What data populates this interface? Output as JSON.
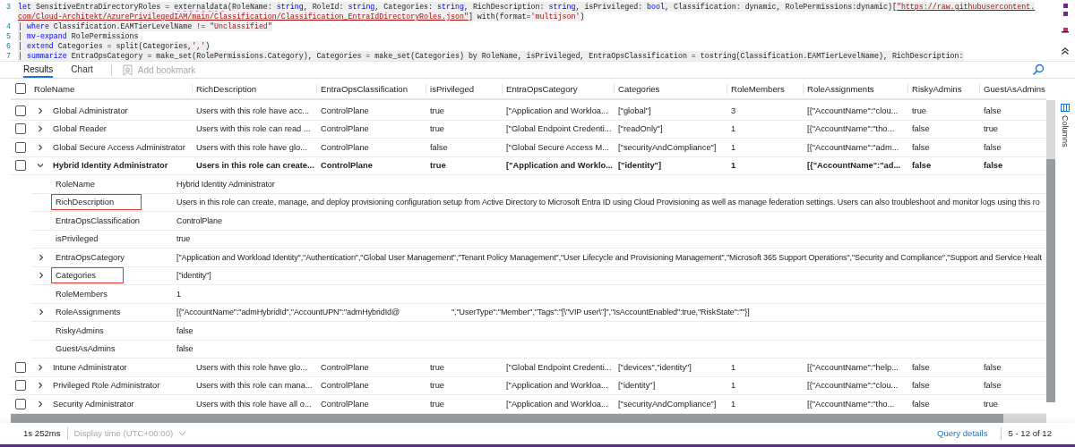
{
  "code": [
    {
      "number": "3",
      "segments": [
        {
          "text": "let",
          "kind": "keyword"
        },
        {
          "text": " SensitiveEntraDirectoryRoles = ",
          "kind": "plain"
        },
        {
          "text": "externaldata",
          "kind": "function"
        },
        {
          "text": "(RoleName: ",
          "kind": "plain"
        },
        {
          "text": "string",
          "kind": "keyword"
        },
        {
          "text": ", RoleId: ",
          "kind": "plain"
        },
        {
          "text": "string",
          "kind": "keyword"
        },
        {
          "text": ", Categories: ",
          "kind": "plain"
        },
        {
          "text": "string",
          "kind": "keyword"
        },
        {
          "text": ", RichDescription: ",
          "kind": "plain"
        },
        {
          "text": "string",
          "kind": "keyword"
        },
        {
          "text": ", isPrivileged: ",
          "kind": "plain"
        },
        {
          "text": "bool",
          "kind": "keyword"
        },
        {
          "text": ", Classification: dynamic, RolePermissions:dynamic)[",
          "kind": "plain"
        },
        {
          "text": "\"https://raw.githubusercontent.",
          "kind": "link"
        }
      ]
    },
    {
      "segments": [
        {
          "text": "com/Cloud-Architekt/AzurePrivilegedIAM/main/Classification/Classification_EntraIdDirectoryRoles.json\"",
          "kind": "link"
        },
        {
          "text": "] with(format=",
          "kind": "plain"
        },
        {
          "text": "'multijson'",
          "kind": "string"
        },
        {
          "text": ")",
          "kind": "plain"
        }
      ]
    },
    {
      "number": "4",
      "segments": [
        {
          "text": "| ",
          "kind": "plain"
        },
        {
          "text": "where",
          "kind": "keyword"
        },
        {
          "text": " Classification.EAMTierLevelName != ",
          "kind": "plain"
        },
        {
          "text": "\"Unclassified\"",
          "kind": "string"
        }
      ]
    },
    {
      "number": "5",
      "segments": [
        {
          "text": "| ",
          "kind": "plain"
        },
        {
          "text": "mv-expand",
          "kind": "keyword"
        },
        {
          "text": " RolePermissions",
          "kind": "plain"
        }
      ]
    },
    {
      "number": "6",
      "segments": [
        {
          "text": "| ",
          "kind": "plain"
        },
        {
          "text": "extend",
          "kind": "keyword"
        },
        {
          "text": " Categories = split(Categories,",
          "kind": "plain"
        },
        {
          "text": "','",
          "kind": "string"
        },
        {
          "text": ")",
          "kind": "plain"
        }
      ]
    },
    {
      "number": "7",
      "segments": [
        {
          "text": "| ",
          "kind": "plain"
        },
        {
          "text": "summarize",
          "kind": "keyword"
        },
        {
          "text": " EntraOpsCategory = make_set(RolePermissions.Category), Categories = make_set(Categories) by RoleName, isPrivileged, EntraOpsClassification = tostring(Classification.EAMTierLevelName), RichDescription:",
          "kind": "plain"
        }
      ]
    }
  ],
  "tabs": [
    {
      "label": "Results",
      "selected": true
    },
    {
      "label": "Chart",
      "selected": false
    }
  ],
  "bookmark": {
    "label": "Add bookmark",
    "disabled": true
  },
  "columns_panel": {
    "label": "Columns"
  },
  "table": {
    "select_all": {
      "checked": false
    },
    "columns": [
      "RoleName",
      "RichDescription",
      "EntraOpsClassification",
      "isPrivileged",
      "EntraOpsCategory",
      "Categories",
      "RoleMembers",
      "RoleAssignments",
      "RiskyAdmins",
      "GuestAsAdmins"
    ],
    "rows": [
      {
        "checked": false,
        "expanded": false,
        "cells": [
          "Global Administrator",
          "Users with this role have acc...",
          "ControlPlane",
          "true",
          "[\"Application and Workloa...",
          "[\"global\"]",
          "3",
          "[{\"AccountName\":\"clou...",
          "true",
          "false"
        ]
      },
      {
        "checked": false,
        "expanded": false,
        "cells": [
          "Global Reader",
          "Users with this role can read ...",
          "ControlPlane",
          "true",
          "[\"Global Endpoint Credenti...",
          "[\"readOnly\"]",
          "1",
          "[{\"AccountName\":\"tho...",
          "false",
          "true"
        ]
      },
      {
        "checked": false,
        "expanded": false,
        "cells": [
          "Global Secure Access Administrator",
          "Users with this role have glo...",
          "ControlPlane",
          "false",
          "[\"Global Secure Access M...",
          "[\"securityAndCompliance\"]",
          "1",
          "[{\"AccountName\":\"adm...",
          "false",
          "false"
        ]
      },
      {
        "checked": false,
        "expanded": true,
        "cells": [
          "Hybrid Identity Administrator",
          "Users in this role can create...",
          "ControlPlane",
          "true",
          "[\"Application and Worklo...",
          "[\"identity\"]",
          "1",
          "[{\"AccountName\":\"ad...",
          "false",
          "false"
        ],
        "details": [
          {
            "key": "RoleName",
            "expandable": false,
            "highlighted": false,
            "values": [
              "Hybrid Identity Administrator"
            ]
          },
          {
            "key": "RichDescription",
            "expandable": false,
            "highlighted": true,
            "values": [
              "Users in this role can create, manage, and deploy provisioning configuration setup from Active Directory to Microsoft Entra ID using Cloud Provisioning as well as manage federation settings. Users can also troubleshoot and monitor logs using this ro"
            ]
          },
          {
            "key": "EntraOpsClassification",
            "expandable": false,
            "highlighted": false,
            "values": [
              "ControlPlane"
            ]
          },
          {
            "key": "isPrivileged",
            "expandable": false,
            "highlighted": false,
            "values": [
              "true"
            ]
          },
          {
            "key": "EntraOpsCategory",
            "expandable": true,
            "highlighted": false,
            "values": [
              "[\"Application and Workload Identity\",\"Authentication\",\"Global User Management\",\"Tenant Policy Management\",\"User Lifecycle and Provisioning Management\",\"Microsoft 365 Support Operations\",\"Security and Compliance\",\"Support and Service Healt"
            ]
          },
          {
            "key": "Categories",
            "expandable": true,
            "highlighted": true,
            "values": [
              "[\"identity\"]"
            ]
          },
          {
            "key": "RoleMembers",
            "expandable": false,
            "highlighted": false,
            "values": [
              "1"
            ]
          },
          {
            "key": "RoleAssignments",
            "expandable": true,
            "highlighted": false,
            "values": [
              "[{\"AccountName\":\"admHybridId\",\"AccountUPN\":\"admHybridId@",
              "\",\"UserType\":\"Member\",\"Tags\":\"[\\\"VIP user\\\"]\",\"IsAccountEnabled\":true,\"RiskState\":\"\"}]"
            ]
          },
          {
            "key": "RiskyAdmins",
            "expandable": false,
            "highlighted": false,
            "values": [
              "false"
            ]
          },
          {
            "key": "GuestAsAdmins",
            "expandable": false,
            "highlighted": false,
            "values": [
              "false"
            ]
          }
        ]
      },
      {
        "checked": false,
        "expanded": false,
        "cells": [
          "Intune Administrator",
          "Users with this role have glo...",
          "ControlPlane",
          "true",
          "[\"Global Endpoint Credenti...",
          "[\"devices\",\"identity\"]",
          "1",
          "[{\"AccountName\":\"help...",
          "false",
          "false"
        ]
      },
      {
        "checked": false,
        "expanded": false,
        "cells": [
          "Privileged Role Administrator",
          "Users with this role can mana...",
          "ControlPlane",
          "true",
          "[\"Application and Workloa...",
          "[\"identity\"]",
          "1",
          "[{\"AccountName\":\"clou...",
          "false",
          "false"
        ]
      },
      {
        "checked": false,
        "expanded": false,
        "cells": [
          "Security Administrator",
          "Users with this role have all o...",
          "ControlPlane",
          "true",
          "[\"Application and Workloa...",
          "[\"securityAndCompliance\"]",
          "1",
          "[{\"AccountName\":\"tho...",
          "false",
          "true"
        ]
      }
    ]
  },
  "footer": {
    "duration": "1s 252ms",
    "time_display": {
      "label": "Display time (UTC+00:00)",
      "disabled": true
    },
    "query_details": "Query details",
    "range": "5 - 12 of 12"
  }
}
